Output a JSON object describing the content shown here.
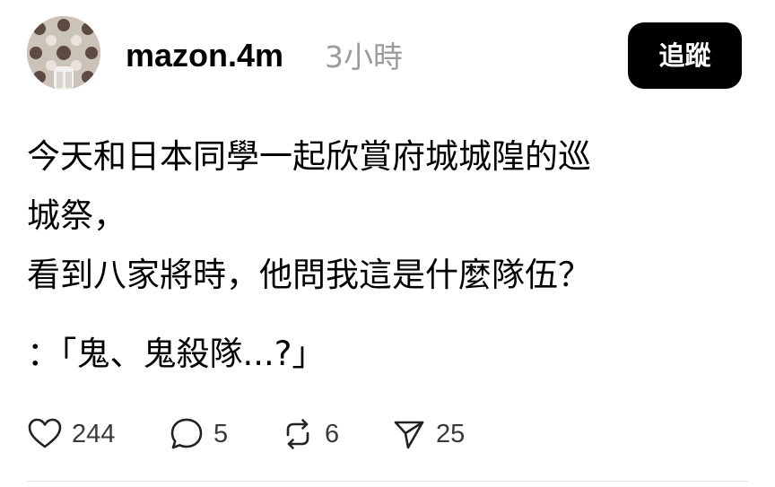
{
  "post": {
    "author": {
      "username": "mazon.4m",
      "avatar_icon": "patterned-tile-avatar"
    },
    "time_ago": "3小時",
    "follow_label": "追蹤",
    "body_lines": [
      "今天和日本同學一起欣賞府城城隍的巡",
      "城祭，",
      "看到八家將時，他問我這是什麼隊伍？",
      "：「鬼、鬼殺隊...?」"
    ],
    "actions": {
      "like": {
        "icon": "heart-icon",
        "count": "244"
      },
      "comment": {
        "icon": "comment-icon",
        "count": "5"
      },
      "repost": {
        "icon": "repost-icon",
        "count": "6"
      },
      "share": {
        "icon": "send-icon",
        "count": "25"
      }
    }
  },
  "colors": {
    "follow_button_bg": "#000000",
    "follow_button_text": "#ffffff",
    "timestamp": "#9b9b9b",
    "action_text": "#3a3a3a"
  }
}
